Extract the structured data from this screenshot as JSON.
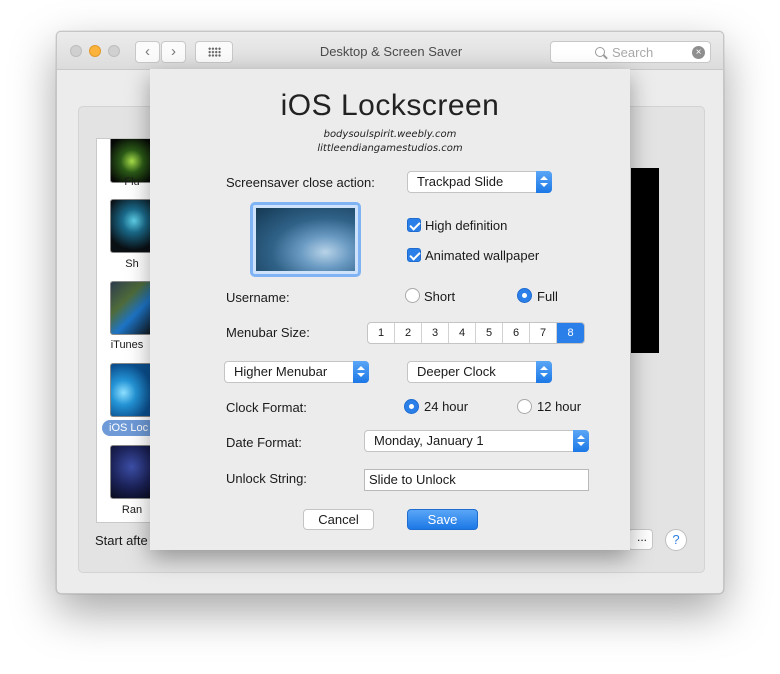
{
  "window": {
    "title": "Desktop & Screen Saver",
    "search_placeholder": "Search",
    "nav_back": "‹",
    "nav_forward": "›",
    "help": "?",
    "start_after_label": "Start afte",
    "options_button": "..."
  },
  "screensaver_list": [
    {
      "label": "Flu"
    },
    {
      "label": "Sh"
    },
    {
      "label": "iTunes"
    },
    {
      "label": "iOS Loc",
      "selected": true
    },
    {
      "label": "Ran"
    }
  ],
  "sheet": {
    "title": "iOS Lockscreen",
    "credit_line1": "bodysoulspirit.weebly.com",
    "credit_line2": "littleendiangamestudios.com",
    "close_action": {
      "label": "Screensaver close action:",
      "value": "Trackpad Slide"
    },
    "high_definition": {
      "label": "High definition",
      "checked": true
    },
    "animated_wallpaper": {
      "label": "Animated wallpaper",
      "checked": true
    },
    "username": {
      "label": "Username:",
      "options": [
        "Short",
        "Full"
      ],
      "selected": "Full"
    },
    "menubar_size": {
      "label": "Menubar Size:",
      "options": [
        "1",
        "2",
        "3",
        "4",
        "5",
        "6",
        "7",
        "8"
      ],
      "selected": "8"
    },
    "menubar_popup": "Higher Menubar",
    "clock_popup": "Deeper Clock",
    "clock_format": {
      "label": "Clock Format:",
      "options": [
        "24 hour",
        "12 hour"
      ],
      "selected": "24 hour"
    },
    "date_format": {
      "label": "Date Format:",
      "value": "Monday, January 1"
    },
    "unlock_string": {
      "label": "Unlock String:",
      "value": "Slide to Unlock"
    },
    "cancel_label": "Cancel",
    "save_label": "Save"
  },
  "colors": {
    "accent": "#2b7fe8",
    "minimize": "#fbb33c"
  }
}
